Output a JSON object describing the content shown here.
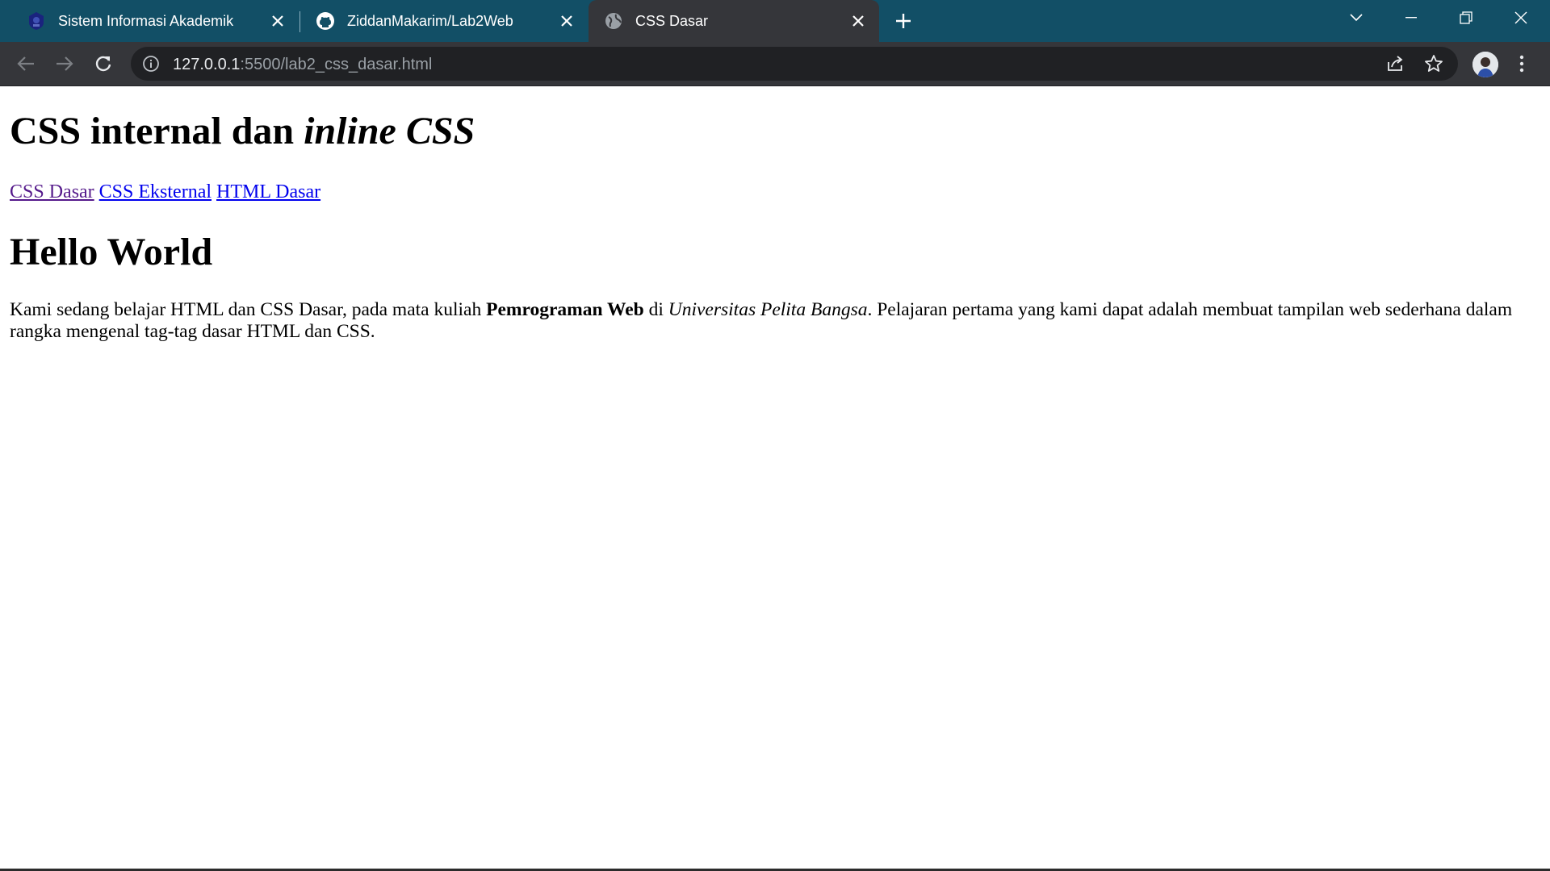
{
  "browser": {
    "tabs": [
      {
        "title": "Sistem Informasi Akademik",
        "icon": "university-logo-icon",
        "active": false
      },
      {
        "title": "ZiddanMakarim/Lab2Web",
        "icon": "github-icon",
        "active": false
      },
      {
        "title": "CSS Dasar",
        "icon": "globe-icon",
        "active": true
      }
    ],
    "address": {
      "host": "127.0.0.1",
      "rest": ":5500/lab2_css_dasar.html"
    },
    "colors": {
      "titlebar": "#124f66",
      "toolbar": "#35363a",
      "omnibox": "#202124"
    }
  },
  "page": {
    "heading": {
      "normal": "CSS internal dan ",
      "italic": "inline CSS"
    },
    "nav_links": [
      {
        "label": "CSS Dasar",
        "visited": true
      },
      {
        "label": "CSS Eksternal",
        "visited": false
      },
      {
        "label": "HTML Dasar",
        "visited": false
      }
    ],
    "subheading": "Hello World",
    "paragraph": {
      "part1": "Kami sedang belajar HTML dan CSS Dasar, pada mata kuliah ",
      "bold": "Pemrograman Web",
      "part2": " di ",
      "italic": "Universitas Pelita Bangsa",
      "part3": ". Pelajaran pertama yang kami dapat adalah membuat tampilan web sederhana dalam rangka mengenal tag-tag dasar HTML dan CSS."
    }
  }
}
